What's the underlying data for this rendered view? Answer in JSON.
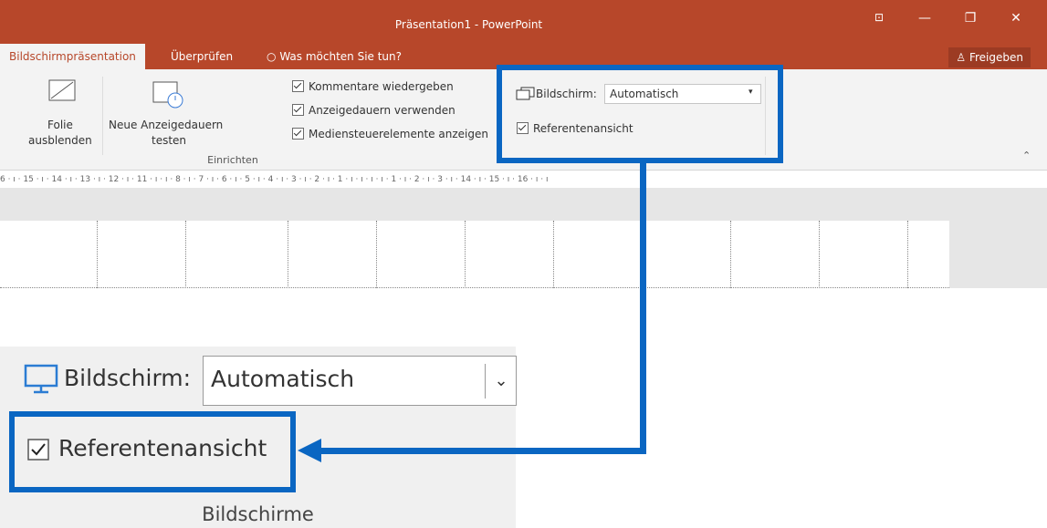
{
  "window": {
    "title": "Präsentation1 - PowerPoint"
  },
  "tabs": {
    "slideshow": "Bildschirmpräsentation",
    "review": "Überprüfen",
    "tellme": "Was möchten Sie tun?"
  },
  "share_label": "Freigeben",
  "ribbon": {
    "hide_slide_line1": "Folie",
    "hide_slide_line2": "ausblenden",
    "rehearse_line1": "Neue Anzeigedauern",
    "rehearse_line2": "testen",
    "group_setup": "Einrichten",
    "play_comments": "Kommentare wiedergeben",
    "use_timings": "Anzeigedauern verwenden",
    "media_controls": "Mediensteuerelemente anzeigen",
    "monitor_label": "Bildschirm:",
    "monitor_value": "Automatisch",
    "presenter_view": "Referentenansicht"
  },
  "ruler_text": "6 · ı · 15 · ı · 14 · ı · 13 · ı · 12 · ı · 11 · ı · ı · 8 · ı · 7 · ı · 6 · ı · 5 · ı · 4 · ı · 3 · ı · 2 · ı · 1 · ı · ı · ı · ı · 1 · ı · 2 · ı · 3 · ı · 14 · ı · 15 · ı · 16 · ı · ı",
  "zoom": {
    "monitor_label": "Bildschirm:",
    "monitor_value": "Automatisch",
    "presenter_view": "Referentenansicht",
    "group_label": "Bildschirme"
  },
  "colors": {
    "accent": "#b7472a",
    "highlight": "#0a66c2"
  }
}
